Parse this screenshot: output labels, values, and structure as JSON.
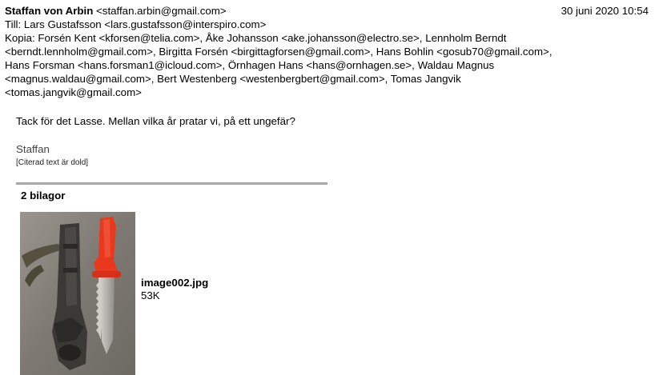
{
  "header": {
    "sender_name": "Staffan von Arbin",
    "sender_email": "<staffan.arbin@gmail.com>",
    "date": "30 juni 2020 10:54",
    "to": "Till: Lars Gustafsson <lars.gustafsson@interspiro.com>",
    "cc_lines": [
      "Kopia: Forsén Kent <kforsen@telia.com>, Åke Johansson <ake.johansson@electro.se>, Lennholm Berndt",
      "<berndt.lennholm@gmail.com>, Birgitta Forsén <birgittagforsen@gmail.com>, Hans Bohlin <gosub70@gmail.com>,",
      "Hans Forsman <hans.forsman1@icloud.com>, Örnhagen Hans <hans@ornhagen.se>, Waldau Magnus",
      "<magnus.waldau@gmail.com>, Bert Westenberg <westenbergbert@gmail.com>, Tomas Jangvik",
      "<tomas.jangvik@gmail.com>"
    ]
  },
  "message": {
    "body": "Tack för det Lasse. Mellan vilka år pratar vi, på ett ungefär?",
    "signature": "Staffan",
    "quoted_note": "[Citerad text är dold]"
  },
  "attachments": {
    "title": "2 bilagor",
    "items": [
      {
        "filename": "image002.jpg",
        "size": "53K"
      }
    ]
  }
}
